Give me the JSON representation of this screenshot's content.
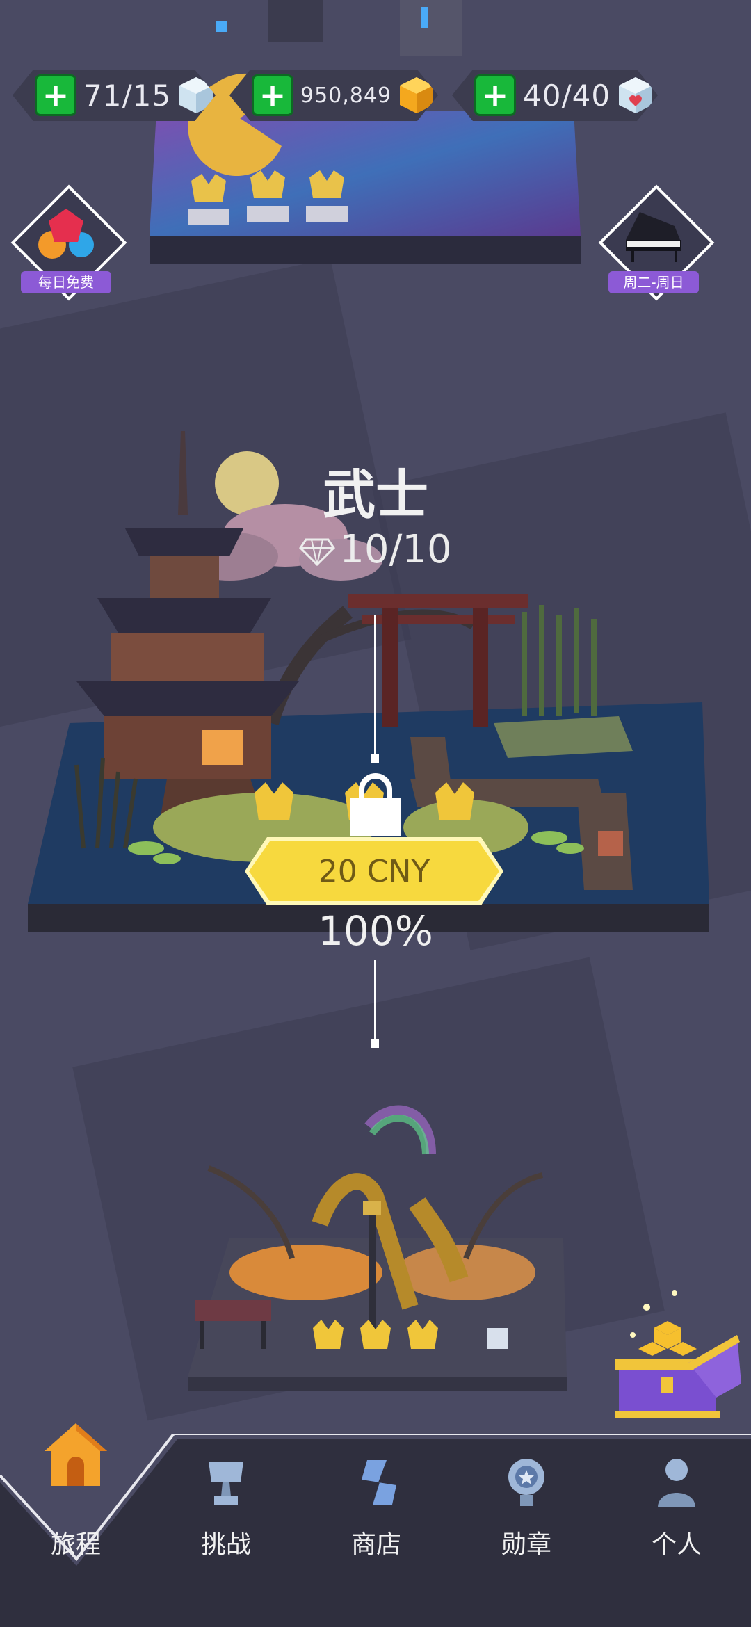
{
  "resources": {
    "lives": "71/15",
    "coins": "950,849",
    "energy": "40/40"
  },
  "side_badges": {
    "daily_free": "每日免费",
    "weekly": "周二-周日"
  },
  "level": {
    "title": "武士",
    "gems": "10/10",
    "price": "20 CNY",
    "progress_text": "100%",
    "progress": 1.0
  },
  "nav": {
    "items": [
      {
        "label": "旅程",
        "icon": "house-icon",
        "active": true
      },
      {
        "label": "挑战",
        "icon": "trophy-icon"
      },
      {
        "label": "商店",
        "icon": "store-icon"
      },
      {
        "label": "勋章",
        "icon": "medal-icon"
      },
      {
        "label": "个人",
        "icon": "person-icon"
      }
    ]
  },
  "colors": {
    "background": "#4a4a63",
    "accent_green": "#18b83a",
    "price_yellow": "#f7d93e",
    "badge_purple": "#8c5ad6"
  }
}
